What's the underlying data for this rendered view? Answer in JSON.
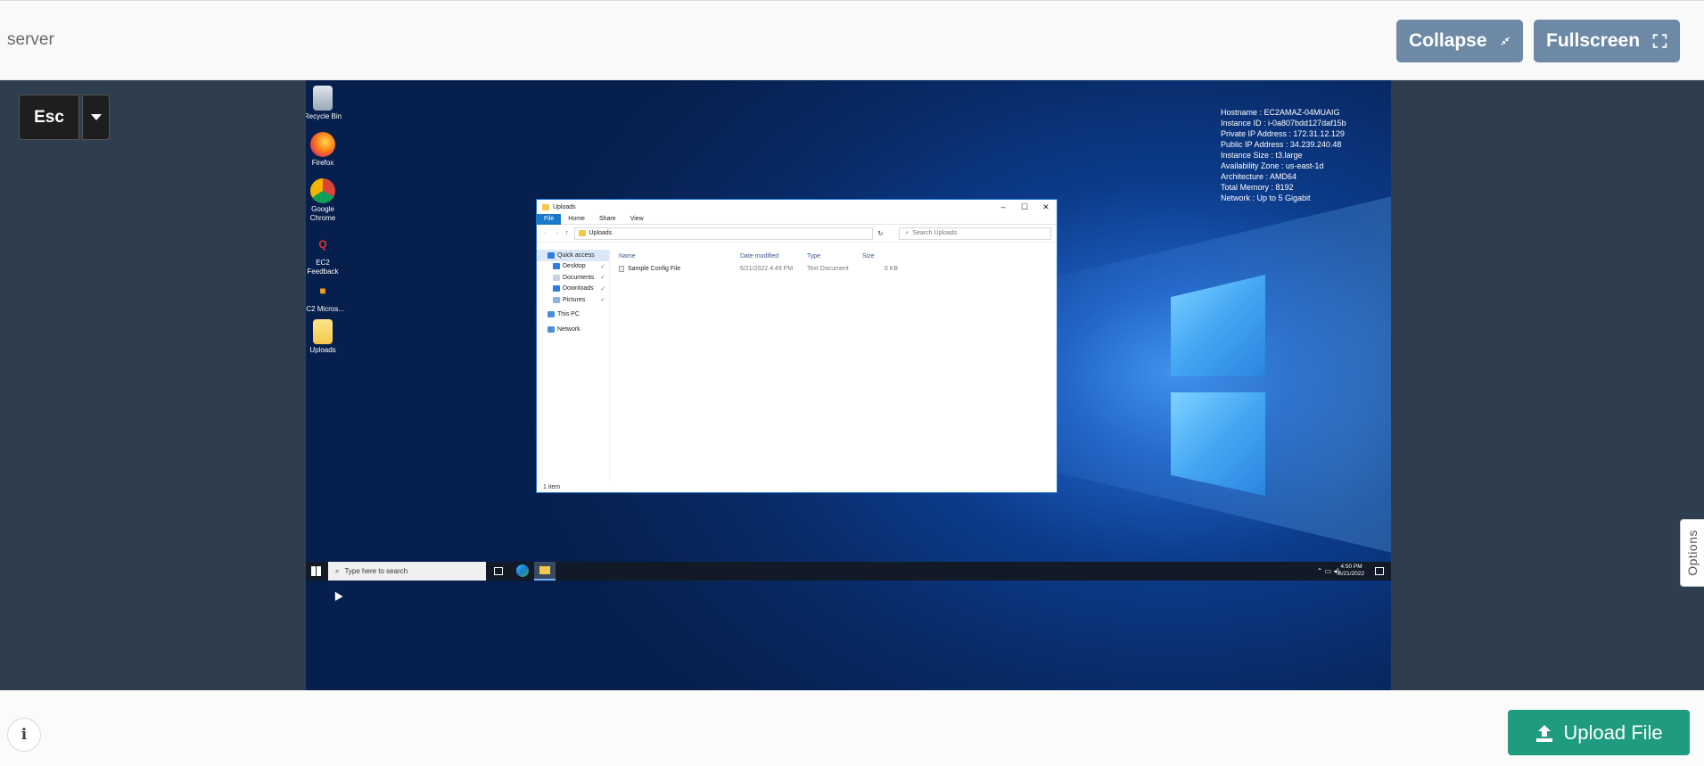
{
  "header": {
    "title": "server",
    "collapse_label": "Collapse",
    "fullscreen_label": "Fullscreen"
  },
  "stage": {
    "esc_label": "Esc",
    "options_label": "Options"
  },
  "desktop": {
    "icons": [
      {
        "label": "Recycle Bin",
        "icon": "recycle-bin-icon"
      },
      {
        "label": "Firefox",
        "icon": "firefox-icon"
      },
      {
        "label": "Google Chrome",
        "icon": "chrome-icon"
      },
      {
        "label": "EC2 Feedback",
        "icon": "ec2-feedback-icon"
      },
      {
        "label": "EC2 Micros...",
        "icon": "ec2-icon"
      },
      {
        "label": "Uploads",
        "icon": "folder-icon"
      }
    ],
    "sysinfo": [
      "Hostname : EC2AMAZ-04MUAIG",
      "Instance ID : i-0a807bdd127daf15b",
      "Private IP Address : 172.31.12.129",
      "Public IP Address : 34.239.240.48",
      "Instance Size : t3.large",
      "Availability Zone : us-east-1d",
      "Architecture : AMD64",
      "Total Memory : 8192",
      "Network : Up to 5 Gigabit"
    ]
  },
  "explorer": {
    "title": "Uploads",
    "ribbon_tabs": [
      "File",
      "Home",
      "Share",
      "View"
    ],
    "address": "Uploads",
    "search_placeholder": "Search Uploads",
    "nav": {
      "quick_access": "Quick access",
      "desktop": "Desktop",
      "documents": "Documents",
      "downloads": "Downloads",
      "pictures": "Pictures",
      "this_pc": "This PC",
      "network": "Network"
    },
    "columns": [
      "Name",
      "Date modified",
      "Type",
      "Size"
    ],
    "rows": [
      {
        "name": "Sample Config File",
        "date": "6/21/2022 4:49 PM",
        "type": "Text Document",
        "size": "0 KB"
      }
    ],
    "status": "1 item"
  },
  "taskbar": {
    "search_placeholder": "Type here to search",
    "time": "4:50 PM",
    "date": "6/21/2022"
  },
  "footer": {
    "upload_label": "Upload File",
    "colors": {
      "upload": "#1f9b80",
      "header_button": "#6d89a5"
    }
  }
}
